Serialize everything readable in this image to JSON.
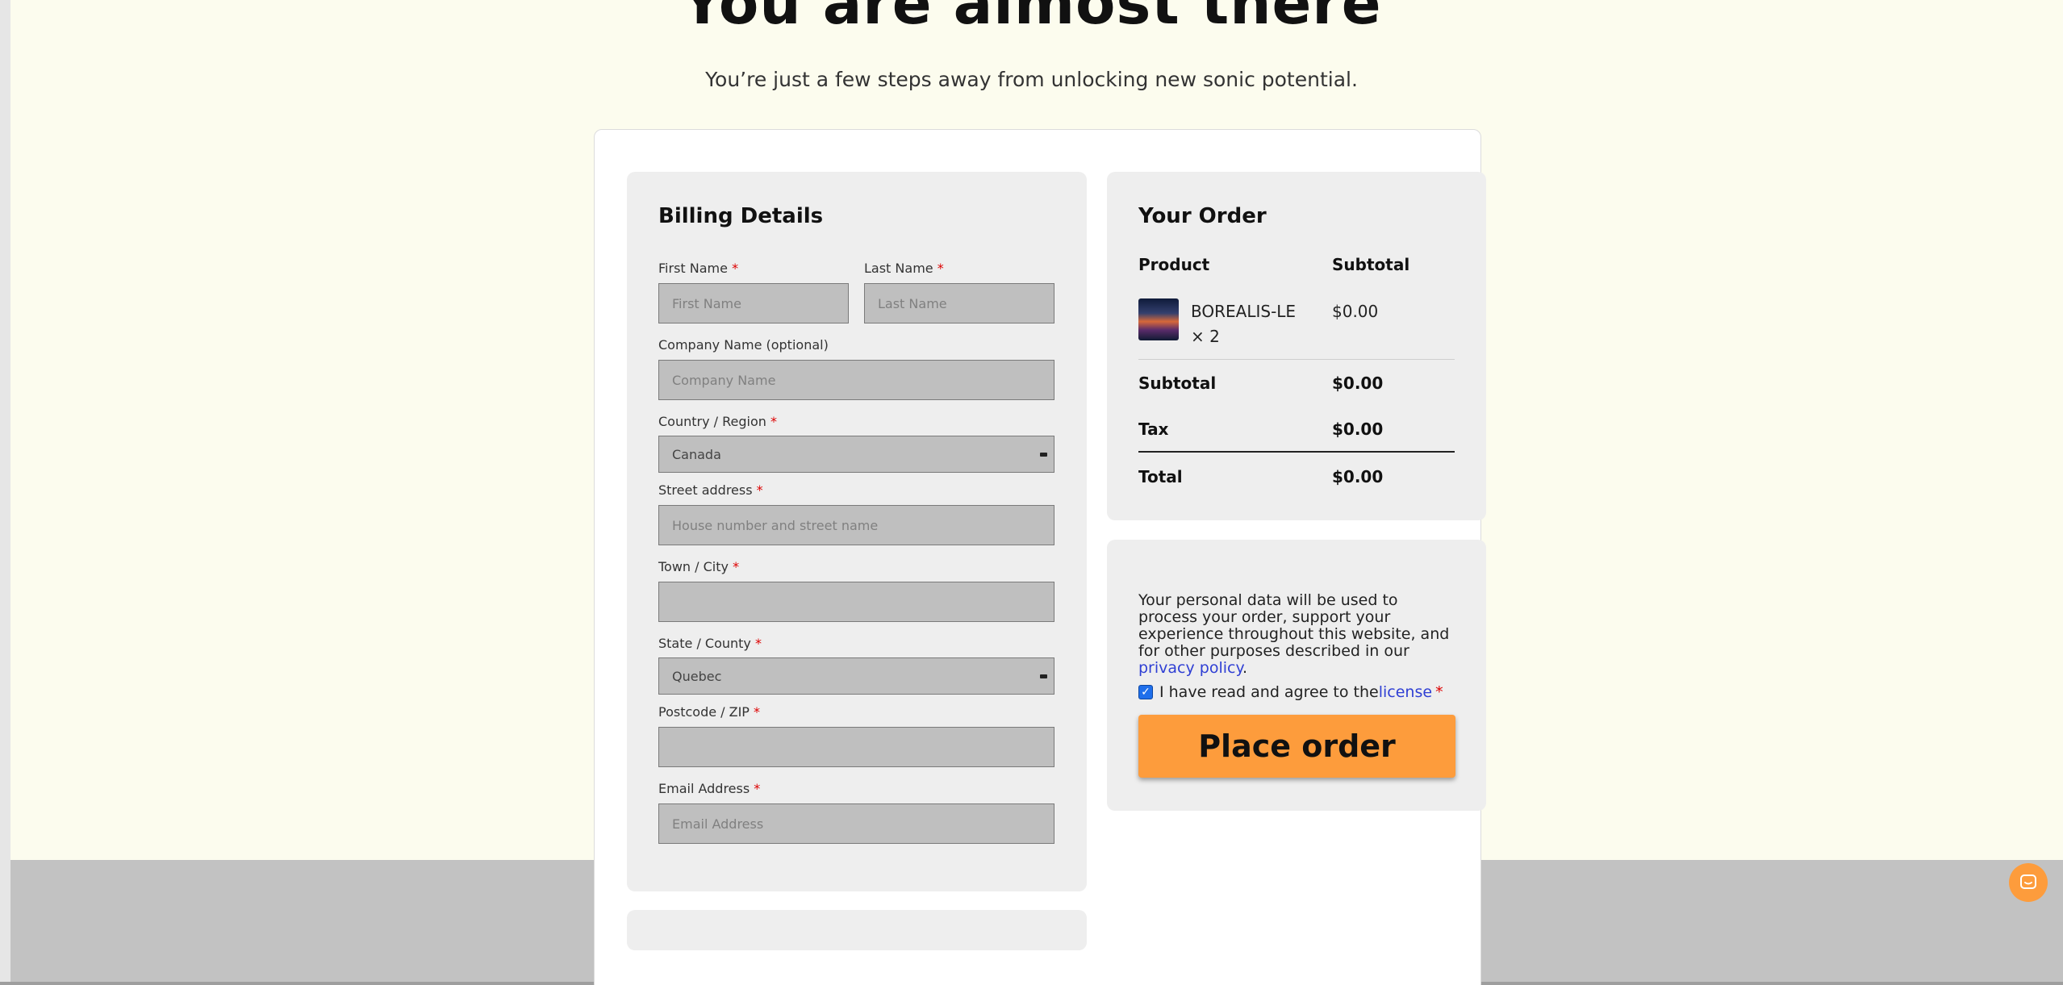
{
  "hero": {
    "title": "You are almost there",
    "subtitle": "You’re just a few steps away from unlocking new sonic potential."
  },
  "billing": {
    "title": "Billing Details",
    "required_mark": "*",
    "first_name": {
      "label": "First Name",
      "placeholder": "First Name",
      "value": ""
    },
    "last_name": {
      "label": "Last Name",
      "placeholder": "Last Name",
      "value": ""
    },
    "company": {
      "label": "Company Name (optional)",
      "placeholder": "Company Name",
      "value": ""
    },
    "country": {
      "label": "Country / Region",
      "selected": "Canada"
    },
    "street": {
      "label": "Street address",
      "placeholder": "House number and street name",
      "value": ""
    },
    "city": {
      "label": "Town / City",
      "value": ""
    },
    "state": {
      "label": "State / County",
      "selected": "Quebec"
    },
    "postcode": {
      "label": "Postcode / ZIP",
      "value": ""
    },
    "email": {
      "label": "Email Address",
      "placeholder": "Email Address",
      "value": ""
    }
  },
  "order": {
    "title": "Your Order",
    "col_product": "Product",
    "col_subtotal": "Subtotal",
    "item": {
      "name": "BOREALIS-LE",
      "qty": "× 2",
      "price": "$0.00"
    },
    "subtotal_label": "Subtotal",
    "subtotal_value": "$0.00",
    "tax_label": "Tax",
    "tax_value": "$0.00",
    "total_label": "Total",
    "total_value": "$0.00"
  },
  "privacy": {
    "text": "Your personal data will be used to process your order, support your experience throughout this website, and for other purposes described in our ",
    "link": "privacy policy",
    "end": ".",
    "agree_text": "I have read and agree to the ",
    "license_link": "license",
    "agree_checked": true
  },
  "place_order_label": "Place order",
  "icons": {
    "chat": "chat-icon",
    "select_arrow": "chevron-down-icon",
    "checkbox": "checkmark-icon"
  },
  "colors": {
    "page_bg": "#fcfcee",
    "accent": "#fd9c3c",
    "link": "#2f3fd4",
    "footer": "#c2c2c2"
  }
}
